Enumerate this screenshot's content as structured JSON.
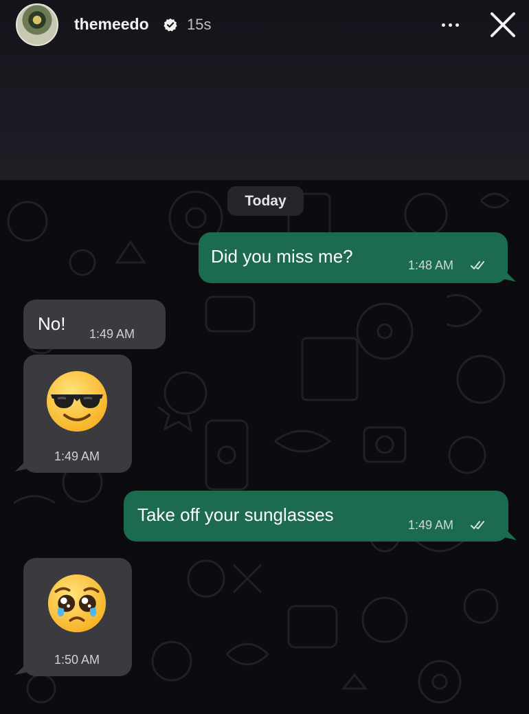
{
  "story": {
    "username": "themeedo",
    "time_ago": "15s",
    "verified_icon": "verified-badge-icon",
    "more_icon": "more-horizontal-icon",
    "close_icon": "close-icon"
  },
  "chat": {
    "date_separator": "Today",
    "messages": [
      {
        "direction": "outgoing",
        "text": "Did you miss me?",
        "time": "1:48 AM",
        "status": "read"
      },
      {
        "direction": "incoming",
        "text": "No!",
        "time": "1:49 AM"
      },
      {
        "direction": "incoming",
        "emoji": "smiling face with sunglasses",
        "time": "1:49 AM"
      },
      {
        "direction": "outgoing",
        "text": "Take off your sunglasses",
        "time": "1:49 AM",
        "status": "read"
      },
      {
        "direction": "incoming",
        "emoji": "pleading face",
        "time": "1:50 AM"
      }
    ]
  },
  "colors": {
    "outgoing_bubble": "#1c6b4f",
    "incoming_bubble": "#3a3a3f",
    "chat_background": "#0c0b0f"
  }
}
